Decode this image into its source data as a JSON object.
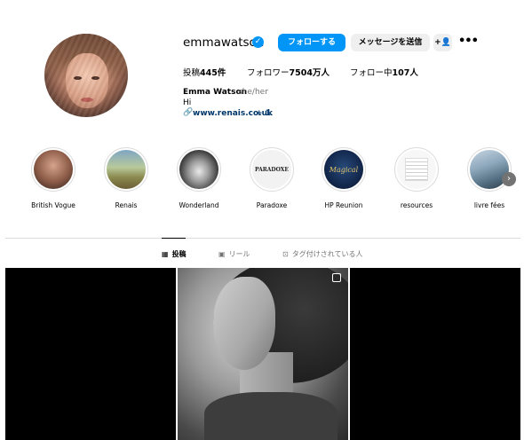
{
  "profile": {
    "username": "emmawatson",
    "follow_label": "フォローする",
    "message_label": "メッセージを送信",
    "suggest_icon": "add-person-icon",
    "more_icon": "more-options-icon",
    "stats": {
      "posts_label": "投稿",
      "posts_value": "445件",
      "followers_label": "フォロワー",
      "followers_value": "7504万人",
      "following_label": "フォロー中",
      "following_value": "107人"
    },
    "full_name": "Emma Watson",
    "pronouns": "she/her",
    "bio": "Hi",
    "link": "www.renais.co.uk",
    "link_more": "+ 1"
  },
  "highlights": [
    {
      "label": "British Vogue"
    },
    {
      "label": "Renais"
    },
    {
      "label": "Wonderland"
    },
    {
      "label": "Paradoxe",
      "cover_text": "PARADOXE"
    },
    {
      "label": "HP Reunion",
      "cover_text": "Magical"
    },
    {
      "label": "resources"
    },
    {
      "label": "livre fées"
    }
  ],
  "tabs": [
    {
      "label": "投稿",
      "icon": "grid-icon",
      "active": true
    },
    {
      "label": "リール",
      "icon": "reels-icon",
      "active": false
    },
    {
      "label": "タグ付けされている人",
      "icon": "tagged-icon",
      "active": false
    }
  ],
  "colors": {
    "accent": "#0095f6",
    "secondary_button": "#efefef",
    "link": "#00376b",
    "muted": "#737373"
  }
}
